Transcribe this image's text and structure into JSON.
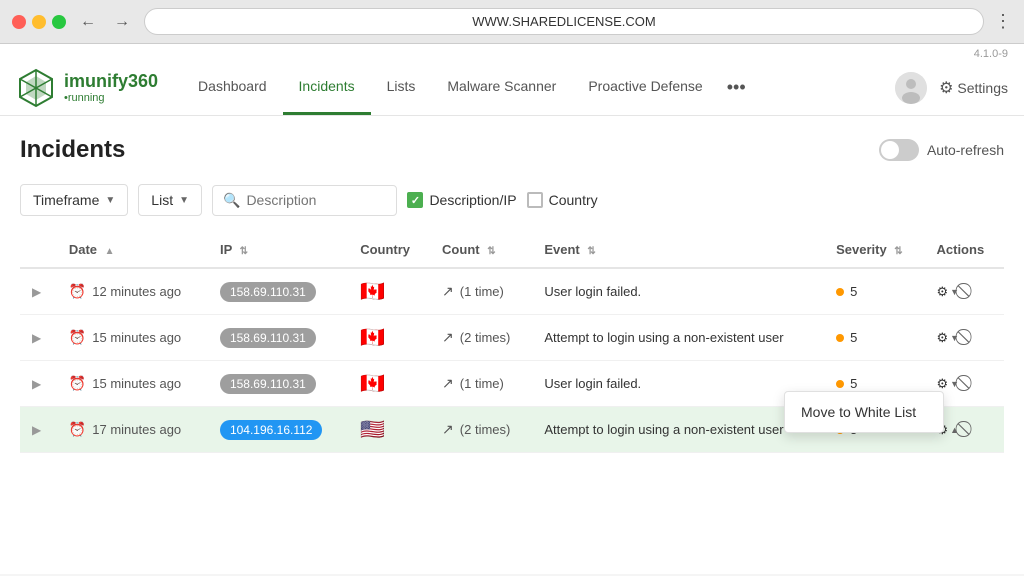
{
  "browser": {
    "url": "WWW.SHAREDLICENSE.COM"
  },
  "app": {
    "version": "4.1.0-9",
    "logo": {
      "name": "imunify360",
      "subtext": "•running"
    },
    "nav": {
      "items": [
        {
          "label": "Dashboard",
          "active": false
        },
        {
          "label": "Incidents",
          "active": true
        },
        {
          "label": "Lists",
          "active": false
        },
        {
          "label": "Malware Scanner",
          "active": false
        },
        {
          "label": "Proactive Defense",
          "active": false
        }
      ],
      "more": "•••",
      "settings": "Settings"
    }
  },
  "page": {
    "title": "Incidents",
    "autoRefreshLabel": "Auto-refresh",
    "filters": {
      "timeframeLabel": "Timeframe",
      "listLabel": "List",
      "searchPlaceholder": "Description",
      "descriptionIPLabel": "Description/IP",
      "countryLabel": "Country"
    },
    "table": {
      "columns": [
        {
          "label": "",
          "key": "expand"
        },
        {
          "label": "Date",
          "key": "date",
          "sortable": true
        },
        {
          "label": "IP",
          "key": "ip",
          "sortable": true
        },
        {
          "label": "Country",
          "key": "country"
        },
        {
          "label": "Count",
          "key": "count",
          "sortable": true
        },
        {
          "label": "Event",
          "key": "event",
          "sortable": true
        },
        {
          "label": "Severity",
          "key": "severity",
          "sortable": true
        },
        {
          "label": "Actions",
          "key": "actions"
        }
      ],
      "rows": [
        {
          "date": "12 minutes ago",
          "ip": "158.69.110.31",
          "ipColor": "gray",
          "country": "CA",
          "countryFlag": "🇨🇦",
          "count": "1 time",
          "event": "User login failed.",
          "severity": "5",
          "highlighted": false
        },
        {
          "date": "15 minutes ago",
          "ip": "158.69.110.31",
          "ipColor": "gray",
          "country": "CA",
          "countryFlag": "🇨🇦",
          "count": "2 times",
          "event": "Attempt to login using a non-existent user",
          "severity": "5",
          "highlighted": false
        },
        {
          "date": "15 minutes ago",
          "ip": "158.69.110.31",
          "ipColor": "gray",
          "country": "CA",
          "countryFlag": "🇨🇦",
          "count": "1 time",
          "event": "User login failed.",
          "severity": "5",
          "highlighted": false
        },
        {
          "date": "17 minutes ago",
          "ip": "104.196.16.112",
          "ipColor": "blue",
          "country": "US",
          "countryFlag": "🇺🇸",
          "count": "2 times",
          "event": "Attempt to login using a non-existent user",
          "severity": "5",
          "highlighted": true
        }
      ]
    },
    "dropdown": {
      "moveToWhiteListLabel": "Move to White List"
    }
  }
}
